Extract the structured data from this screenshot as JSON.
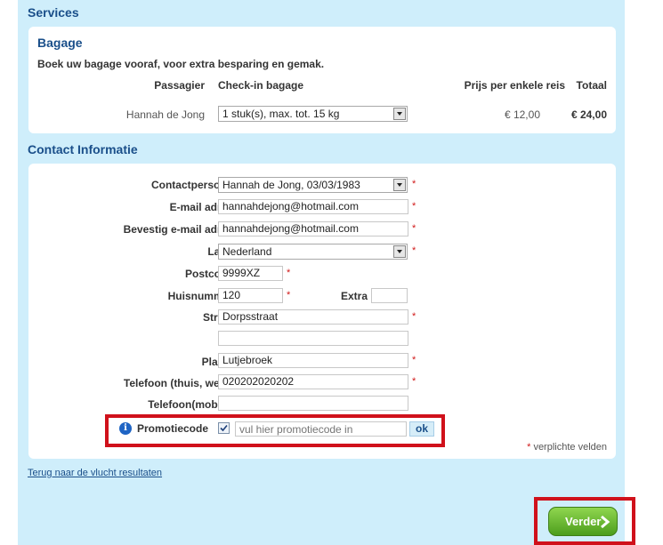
{
  "services": {
    "title": "Services",
    "bagage": {
      "title": "Bagage",
      "intro": "Boek uw bagage vooraf, voor extra besparing en gemak.",
      "headers": {
        "passenger": "Passagier",
        "checkin": "Check-in bagage",
        "price": "Prijs per enkele reis",
        "total": "Totaal"
      },
      "row": {
        "passenger": "Hannah de Jong",
        "checkin": "1 stuk(s), max. tot. 15 kg",
        "price": "€ 12,00",
        "total": "€ 24,00"
      }
    }
  },
  "contact": {
    "title": "Contact Informatie",
    "required_mark": "*",
    "fields": {
      "contactpersoon": {
        "label": "Contactpersoon",
        "value": "Hannah de Jong, 03/03/1983"
      },
      "email": {
        "label": "E-mail adres",
        "value": "hannahdejong@hotmail.com"
      },
      "email_confirm": {
        "label": "Bevestig e-mail adres",
        "value": "hannahdejong@hotmail.com"
      },
      "land": {
        "label": "Land",
        "value": "Nederland"
      },
      "postcode": {
        "label": "Postcode",
        "value": "9999XZ"
      },
      "huisnummer": {
        "label": "Huisnummer",
        "value": "120"
      },
      "extra": {
        "label": "Extra",
        "value": ""
      },
      "straat": {
        "label": "Straat",
        "value": "Dorpsstraat",
        "value2": ""
      },
      "plaats": {
        "label": "Plaats",
        "value": "Lutjebroek"
      },
      "telefoon": {
        "label": "Telefoon (thuis, werk)",
        "value": "020202020202"
      },
      "telefoon_mobiel": {
        "label": "Telefoon(mobiel)",
        "value": ""
      }
    },
    "promo": {
      "label": "Promotiecode",
      "placeholder": "vul hier promotiecode in",
      "ok_label": "ok",
      "checked": true
    },
    "required_note": "verplichte velden"
  },
  "back_link": "Terug naar de vlucht resultaten",
  "next_button": "Verder",
  "colors": {
    "panel": "#cfeefb",
    "title": "#1a4f8a",
    "highlight": "#d0111b",
    "button": "#5fb52a"
  },
  "icons": {
    "info": "info-icon",
    "next": "chevron-right-icon",
    "dropdown": "chevron-down-icon"
  }
}
